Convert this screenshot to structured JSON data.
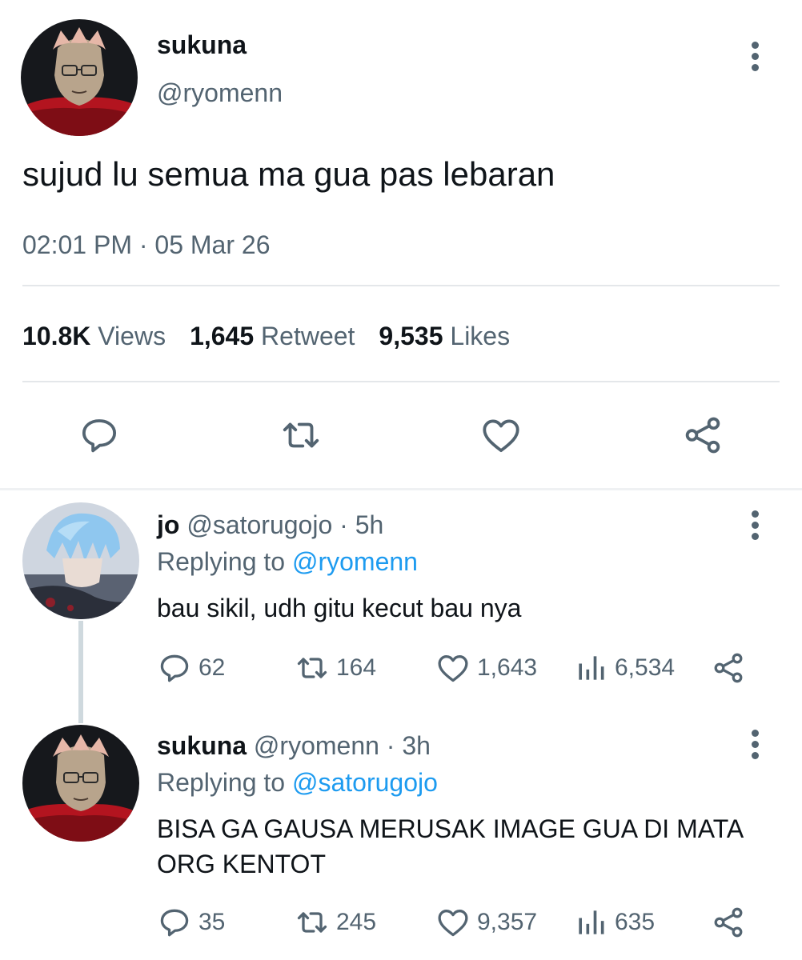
{
  "main_tweet": {
    "name": "sukuna",
    "handle": "@ryomenn",
    "text": "sujud lu semua ma gua pas lebaran",
    "timestamp": "02:01 PM · 05 Mar 26",
    "stats": {
      "views_count": "10.8K",
      "views_label": "Views",
      "retweets_count": "1,645",
      "retweets_label": "Retweet",
      "likes_count": "9,535",
      "likes_label": "Likes"
    },
    "icons": [
      "reply-icon",
      "retweet-icon",
      "like-icon",
      "share-icon"
    ]
  },
  "replies": [
    {
      "name": "jo",
      "handle_time": "@satorugojo · 5h",
      "replying_label": "Replying to",
      "replying_to": "@ryomenn",
      "text": "bau sikil, udh gitu kecut bau nya",
      "counts": {
        "replies": "62",
        "retweets": "164",
        "likes": "1,643",
        "views": "6,534"
      }
    },
    {
      "name": "sukuna",
      "handle_time": "@ryomenn · 3h",
      "replying_label": "Replying to",
      "replying_to": "@satorugojo",
      "text": "BISA GA GAUSA MERUSAK IMAGE GUA DI MATA ORG KENTOT",
      "counts": {
        "replies": "35",
        "retweets": "245",
        "likes": "9,357",
        "views": "635"
      }
    }
  ],
  "colors": {
    "text": "#0f1419",
    "secondary": "#536471",
    "link": "#1d9bf0",
    "divider": "#e4e7ea",
    "thread_line": "#cfd9de"
  }
}
